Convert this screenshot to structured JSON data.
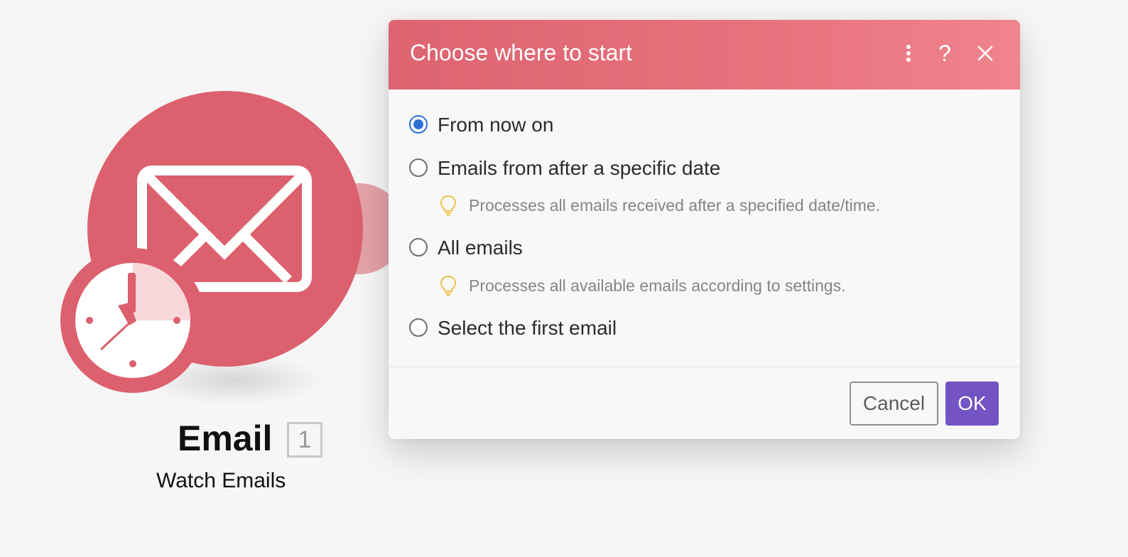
{
  "module": {
    "title": "Email",
    "badge": "1",
    "subtitle": "Watch Emails",
    "icon": "envelope-icon",
    "trigger_icon": "clock-icon",
    "color": "#dc606d"
  },
  "dialog": {
    "title": "Choose where to start",
    "header_actions": {
      "more": "more-vertical-icon",
      "help": "?",
      "close": "close-icon"
    },
    "options": [
      {
        "label": "From now on",
        "selected": true
      },
      {
        "label": "Emails from after a specific date",
        "selected": false,
        "hint": "Processes all emails received after a specified date/time."
      },
      {
        "label": "All emails",
        "selected": false,
        "hint": "Processes all available emails according to settings."
      },
      {
        "label": "Select the first email",
        "selected": false
      }
    ],
    "buttons": {
      "cancel": "Cancel",
      "ok": "OK"
    },
    "colors": {
      "header": "#e36d78",
      "radio_selected": "#2d6fd6",
      "ok_button": "#7354c2",
      "hint_icon": "#f0c04a"
    }
  }
}
